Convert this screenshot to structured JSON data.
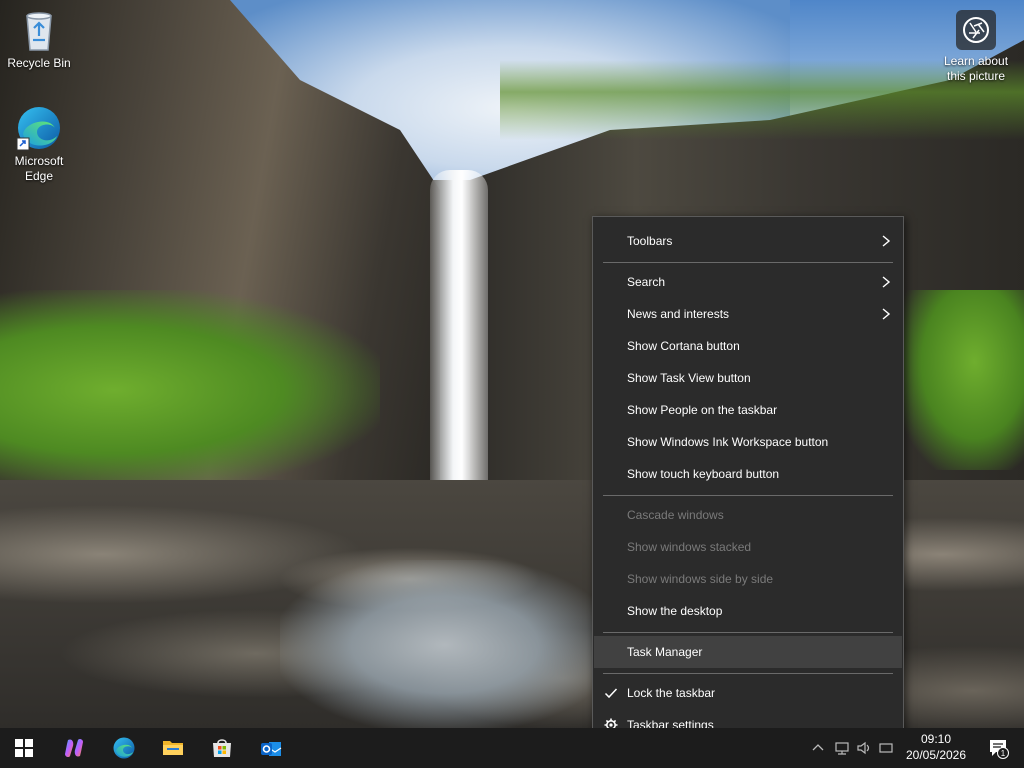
{
  "desktop": {
    "icons": [
      {
        "label": "Recycle Bin",
        "icon": "recycle-bin-icon"
      },
      {
        "label": "Microsoft Edge",
        "icon": "edge-icon"
      }
    ],
    "learn_about": {
      "label": "Learn about this picture",
      "icon": "camera-icon"
    }
  },
  "context_menu": {
    "items": [
      {
        "label": "Toolbars",
        "submenu": true,
        "enabled": true
      },
      {
        "label": "Search",
        "submenu": true,
        "enabled": true
      },
      {
        "label": "News and interests",
        "submenu": true,
        "enabled": true
      },
      {
        "label": "Show Cortana button",
        "enabled": true
      },
      {
        "label": "Show Task View button",
        "enabled": true
      },
      {
        "label": "Show People on the taskbar",
        "enabled": true
      },
      {
        "label": "Show Windows Ink Workspace button",
        "enabled": true
      },
      {
        "label": "Show touch keyboard button",
        "enabled": true
      },
      {
        "label": "Cascade windows",
        "enabled": false
      },
      {
        "label": "Show windows stacked",
        "enabled": false
      },
      {
        "label": "Show windows side by side",
        "enabled": false
      },
      {
        "label": "Show the desktop",
        "enabled": true
      },
      {
        "label": "Task Manager",
        "enabled": true,
        "hovered": true
      },
      {
        "label": "Lock the taskbar",
        "enabled": true,
        "checked": true
      },
      {
        "label": "Taskbar settings",
        "enabled": true,
        "icon": "gear-icon"
      }
    ]
  },
  "taskbar": {
    "buttons": [
      "start-icon",
      "copilot-icon",
      "edge-icon",
      "file-explorer-icon",
      "microsoft-store-icon",
      "outlook-icon"
    ],
    "clock": {
      "time": "09:10",
      "date": "20/05/2026"
    },
    "notification_count": "1"
  },
  "colors": {
    "menu_bg": "#2b2b2b",
    "menu_hover": "#414141",
    "taskbar_bg": "#1c1c1c",
    "disabled_text": "#7a7a7a"
  }
}
